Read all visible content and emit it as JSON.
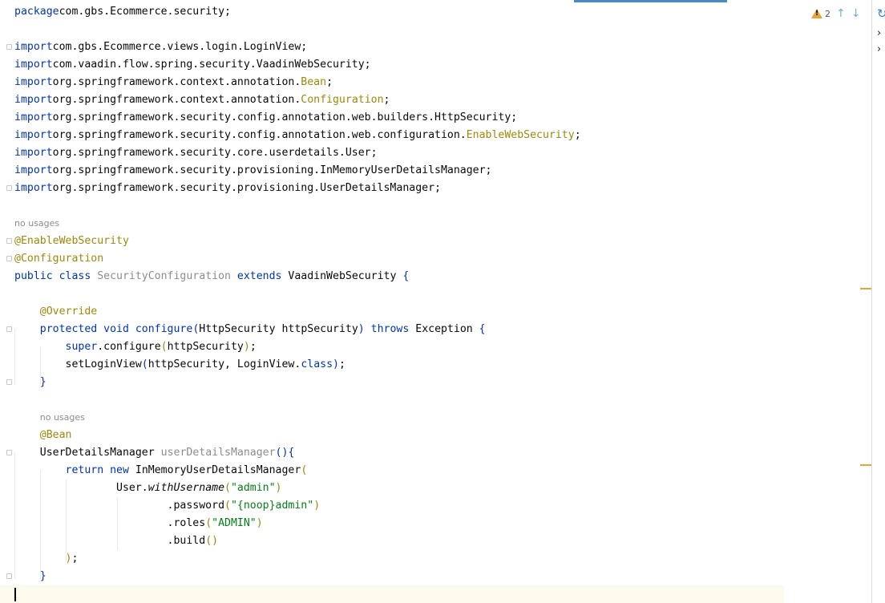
{
  "editor": {
    "lines": [
      [
        [
          "kw",
          "package"
        ],
        [
          "",
          "com.gbs.Ecommerce.security;"
        ]
      ],
      [],
      [
        [
          "kw",
          "import"
        ],
        [
          "",
          "com.gbs.Ecommerce.views.login.LoginView;"
        ]
      ],
      [
        [
          "kw",
          "import"
        ],
        [
          "",
          "com.vaadin.flow.spring.security.VaadinWebSecurity;"
        ]
      ],
      [
        [
          "kw",
          "import"
        ],
        [
          "",
          "org.springframework.context.annotation."
        ],
        [
          "ann",
          "Bean"
        ],
        [
          "",
          ";"
        ]
      ],
      [
        [
          "kw",
          "import"
        ],
        [
          "",
          "org.springframework.context.annotation."
        ],
        [
          "ann",
          "Configuration"
        ],
        [
          "",
          ";"
        ]
      ],
      [
        [
          "kw",
          "import"
        ],
        [
          "",
          "org.springframework.security.config.annotation.web.builders.HttpSecurity;"
        ]
      ],
      [
        [
          "kw",
          "import"
        ],
        [
          "",
          "org.springframework.security.config.annotation.web.configuration."
        ],
        [
          "ann",
          "EnableWebSecurity"
        ],
        [
          "",
          ";"
        ]
      ],
      [
        [
          "kw",
          "import"
        ],
        [
          "",
          "org.springframework.security.core.userdetails.User;"
        ]
      ],
      [
        [
          "kw",
          "import"
        ],
        [
          "",
          "org.springframework.security.provisioning.InMemoryUserDetailsManager;"
        ]
      ],
      [
        [
          "kw",
          "import"
        ],
        [
          "",
          "org.springframework.security.provisioning.UserDetailsManager;"
        ]
      ],
      [],
      [
        [
          "hint",
          "no usages"
        ]
      ],
      [
        [
          "ann",
          "@EnableWebSecurity"
        ]
      ],
      [
        [
          "ann",
          "@Configuration"
        ]
      ],
      [
        [
          "kw",
          "public class "
        ],
        [
          "gray",
          "SecurityConfiguration "
        ],
        [
          "kw",
          "extends "
        ],
        [
          "",
          "VaadinWebSecurity "
        ],
        [
          "kw",
          "{"
        ]
      ],
      [],
      [
        [
          "",
          "    "
        ],
        [
          "ann",
          "@Override"
        ]
      ],
      [
        [
          "",
          "    "
        ],
        [
          "kw",
          "protected void "
        ],
        [
          "kw",
          "configure"
        ],
        [
          "kw",
          "("
        ],
        [
          "",
          "HttpSecurity httpSecurity"
        ],
        [
          "kw",
          ") throws "
        ],
        [
          "",
          "Exception "
        ],
        [
          "kw",
          "{"
        ]
      ],
      [
        [
          "",
          "        "
        ],
        [
          "kw",
          "super"
        ],
        [
          "",
          ".configure"
        ],
        [
          "ann",
          "("
        ],
        [
          "",
          "httpSecurity"
        ],
        [
          "ann",
          ")"
        ],
        [
          "",
          ";"
        ]
      ],
      [
        [
          "",
          "        setLoginView"
        ],
        [
          "kw",
          "("
        ],
        [
          "",
          "httpSecurity, LoginView."
        ],
        [
          "kw",
          "class"
        ],
        [
          "kw",
          ")"
        ],
        [
          "",
          ";"
        ]
      ],
      [
        [
          "",
          "    "
        ],
        [
          "kw",
          "}"
        ]
      ],
      [],
      [
        [
          "",
          "    "
        ],
        [
          "hint",
          "no usages"
        ]
      ],
      [
        [
          "",
          "    "
        ],
        [
          "ann",
          "@Bean"
        ]
      ],
      [
        [
          "",
          "    UserDetailsManager "
        ],
        [
          "gray",
          "userDetailsManager"
        ],
        [
          "kw",
          "(){"
        ]
      ],
      [
        [
          "",
          "        "
        ],
        [
          "kw",
          "return new "
        ],
        [
          "",
          "InMemoryUserDetailsManager"
        ],
        [
          "ann",
          "("
        ]
      ],
      [
        [
          "",
          "                User."
        ],
        [
          "ital",
          "withUsername"
        ],
        [
          "ann",
          "("
        ],
        [
          "str",
          "\"admin\""
        ],
        [
          "ann",
          ")"
        ]
      ],
      [
        [
          "",
          "                        .password"
        ],
        [
          "ann",
          "("
        ],
        [
          "str",
          "\"{noop}admin\""
        ],
        [
          "ann",
          ")"
        ]
      ],
      [
        [
          "",
          "                        .roles"
        ],
        [
          "ann",
          "("
        ],
        [
          "str",
          "\"ADMIN\""
        ],
        [
          "ann",
          ")"
        ]
      ],
      [
        [
          "",
          "                        .build"
        ],
        [
          "ann",
          "()"
        ]
      ],
      [
        [
          "",
          "        "
        ],
        [
          "ann",
          ")"
        ],
        [
          "",
          ";"
        ]
      ],
      [
        [
          "",
          "    "
        ],
        [
          "kw",
          "}"
        ]
      ],
      []
    ]
  },
  "inspections": {
    "warning_count": "2",
    "warning_icon": "warning-triangle-icon",
    "prev_icon": "arrow-up-icon",
    "next_icon": "arrow-down-icon",
    "prev_glyph": "↑",
    "next_glyph": "↓"
  },
  "side_panel": {
    "chevron_glyph": "›",
    "refresh_glyph": "↻"
  },
  "colors": {
    "keyword": "#0033b3",
    "annotation": "#9e880d",
    "string": "#067d17",
    "warning": "#e8a33d",
    "caret_line": "#fcfaed"
  }
}
